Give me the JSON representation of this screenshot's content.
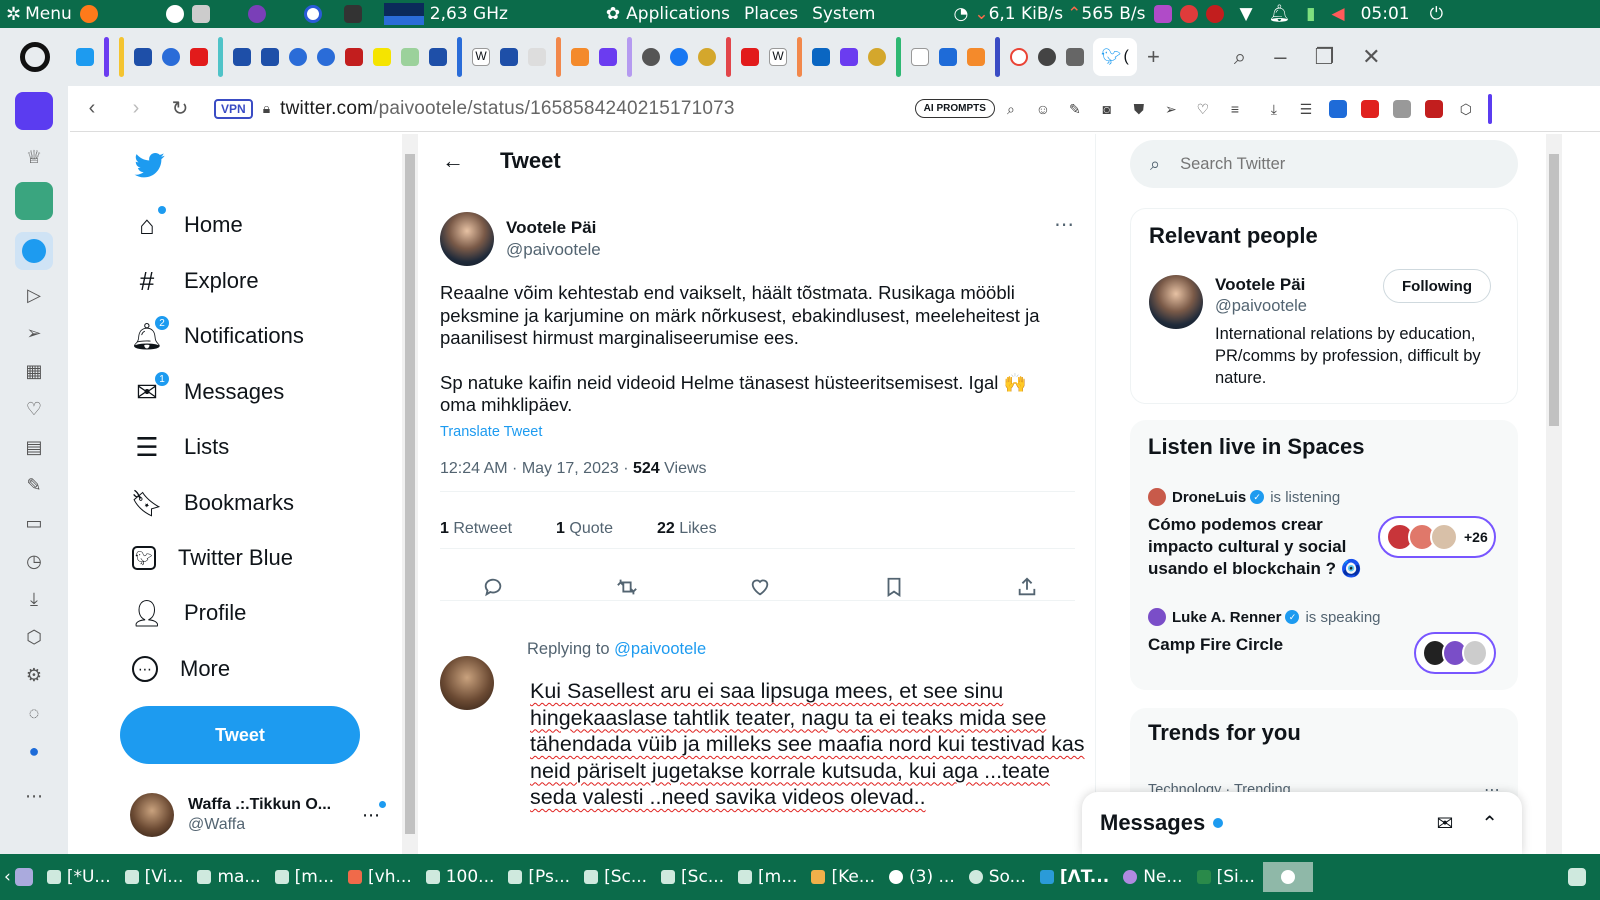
{
  "system_panel": {
    "menu_label": "Menu",
    "cpu_freq": "2,63 GHz",
    "menus": [
      "Applications",
      "Places",
      "System"
    ],
    "net_down": "6,1 KiB/s",
    "net_up": "565 B/s",
    "clock": "05:01"
  },
  "browser": {
    "address": {
      "vpn_label": "VPN",
      "url_host": "twitter.com",
      "url_path": "/paivootele/status/1658584240215171073",
      "ai_prompts_label": "AI PROMPTS"
    },
    "active_tab_label": "("
  },
  "twitter": {
    "nav": {
      "items": [
        {
          "label": "Home",
          "icon": "home-icon"
        },
        {
          "label": "Explore",
          "icon": "hash-icon"
        },
        {
          "label": "Notifications",
          "icon": "bell-icon",
          "badge": "2"
        },
        {
          "label": "Messages",
          "icon": "mail-icon",
          "badge": "1"
        },
        {
          "label": "Lists",
          "icon": "list-icon"
        },
        {
          "label": "Bookmarks",
          "icon": "bookmark-icon"
        },
        {
          "label": "Twitter Blue",
          "icon": "twitter-blue-icon"
        },
        {
          "label": "Profile",
          "icon": "person-icon"
        },
        {
          "label": "More",
          "icon": "more-circle-icon"
        }
      ],
      "tweet_button": "Tweet",
      "account": {
        "name": "Waffa .:.Tikkun O...",
        "handle": "@Waffa"
      }
    },
    "main": {
      "header_title": "Tweet",
      "tweet": {
        "author_name": "Vootele Päi",
        "author_handle": "@paivootele",
        "text_p1": "Reaalne võim kehtestab end vaikselt, häält tõstmata. Rusikaga mööbli peksmine ja karjumine on märk nõrkusest, ebakindlusest, meeleheitest ja paanilisest hirmust marginaliseerumise ees.",
        "text_p2": "Sp natuke kaifin neid videoid Helme tänasest hüsteeritsemisest. Igal 🙌 oma mihklipäev.",
        "translate_label": "Translate Tweet",
        "time": "12:24 AM · May 17, 2023 · ",
        "views_count": "524",
        "views_label": " Views",
        "retweets_count": "1",
        "retweets_label": " Retweet",
        "quotes_count": "1",
        "quotes_label": " Quote",
        "likes_count": "22",
        "likes_label": " Likes"
      },
      "reply": {
        "replying_to_label": "Replying to ",
        "replying_to_handle": "@paivootele",
        "draft_text": "Kui Sasellest aru ei saa lipsuga mees, et see sinu hingekaaslase tahtlik teater, nagu ta ei teaks mida see tähendada vüib ja milleks see maafia nord kui testivad kas neid päriselt jugetakse korrale kutsuda, kui aga ...teate seda valesti ..need savika videos olevad.."
      }
    },
    "right": {
      "search_placeholder": "Search Twitter",
      "relevant": {
        "title": "Relevant people",
        "name": "Vootele Päi",
        "handle": "@paivootele",
        "bio": "International relations by education, PR/comms by profession, difficult by nature.",
        "follow_label": "Following"
      },
      "spaces": {
        "title": "Listen live in Spaces",
        "items": [
          {
            "host": "DroneLuis",
            "status": "is listening",
            "title": "Cómo podemos crear impacto cultural y social usando el blockchain ? 🧿",
            "extra": "+26"
          },
          {
            "host": "Luke A. Renner",
            "status": "is speaking",
            "title": "Camp Fire Circle"
          }
        ]
      },
      "trends": {
        "title": "Trends for you",
        "first_context": "Technology · Trending"
      },
      "messages_drawer_title": "Messages"
    }
  },
  "taskbar": {
    "items": [
      "[*U...",
      "[Vi...",
      "ma...",
      "[m...",
      "[vh...",
      "100...",
      "[Ps...",
      "[Sc...",
      "[Sc...",
      "[m...",
      "[Ke...",
      "(3) ...",
      "So...",
      "[ΛT...",
      "Ne...",
      "[Si..."
    ]
  },
  "colors": {
    "accent": "#1d9bf0",
    "panel": "#0b6b4a",
    "spell_error": "#e0211e"
  }
}
